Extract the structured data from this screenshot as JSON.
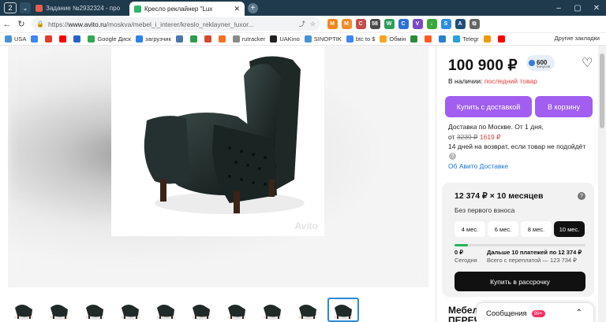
{
  "browser": {
    "tab_count": "2",
    "tabs": [
      {
        "title": "Задание №2932324 - про",
        "color": "#e65c4f",
        "active": false
      },
      {
        "title": "Кресло реклайнер \"Lux",
        "color": "#2fb36b",
        "active": true
      }
    ],
    "url_prefix": "https://",
    "url_host": "www.avito.ru",
    "url_path": "/moskva/mebel_i_interer/kreslo_reklayner_luxor...",
    "window_controls": [
      "–",
      "▢",
      "✕"
    ],
    "extensions": [
      {
        "name": "metamask-icon",
        "color": "#f6851b",
        "label": "M"
      },
      {
        "name": "ext-icon-2",
        "color": "#f28c28",
        "label": "M"
      },
      {
        "name": "ext-icon-3",
        "color": "#c94b4b",
        "label": "C"
      },
      {
        "name": "ltc-icon",
        "color": "#4a4a4a",
        "label": "58"
      },
      {
        "name": "ext-icon-5",
        "color": "#2f9c5a",
        "label": "W"
      },
      {
        "name": "ext-icon-6",
        "color": "#2c6fd6",
        "label": "C"
      },
      {
        "name": "ext-icon-7",
        "color": "#7a49c8",
        "label": "V"
      },
      {
        "name": "download-icon",
        "color": "#38a838",
        "label": "↓"
      },
      {
        "name": "ext-icon-9",
        "color": "#2b8de0",
        "label": "S"
      },
      {
        "name": "ext-icon-10",
        "color": "#1f4e79",
        "label": "A"
      },
      {
        "name": "puzzle-icon",
        "color": "#666666",
        "label": "⧉"
      }
    ],
    "bookmarks": [
      {
        "label": "USA",
        "color": "#4a90d9"
      },
      {
        "label": "",
        "color": "#4285f4"
      },
      {
        "label": "",
        "color": "#e33b2e"
      },
      {
        "label": "",
        "color": "#ff0000"
      },
      {
        "label": "",
        "color": "#2563c9"
      },
      {
        "label": "Google Диск",
        "color": "#34a853"
      },
      {
        "label": "загрузчик",
        "color": "#2f80ed"
      },
      {
        "label": "",
        "color": "#4a76a8"
      },
      {
        "label": "",
        "color": "#2c9c4e"
      },
      {
        "label": "",
        "color": "#d04a2f"
      },
      {
        "label": "",
        "color": "#f37021"
      },
      {
        "label": "rutracker",
        "color": "#8a8a8a"
      },
      {
        "label": "UAKino",
        "color": "#222222"
      },
      {
        "label": "SINOPTIK",
        "color": "#4a90d9"
      },
      {
        "label": "btc to $",
        "color": "#4285f4"
      },
      {
        "label": "Обмін",
        "color": "#f5a623"
      },
      {
        "label": "",
        "color": "#2c8c3c"
      },
      {
        "label": "",
        "color": "#ff5a1f"
      },
      {
        "label": "",
        "color": "#2d7dd2"
      },
      {
        "label": "Telegr",
        "color": "#2aa1da"
      },
      {
        "label": "",
        "color": "#f29900"
      },
      {
        "label": "",
        "color": "#ff0000"
      }
    ],
    "other_bookmarks": "Другие закладки"
  },
  "product": {
    "watermark": "Avito",
    "price": "100 900 ₽",
    "bonus_amount": "600",
    "bonus_label": "бонусов",
    "stock_label": "В наличии:",
    "stock_value": "последний товар",
    "buy_delivery": "Купить с доставкой",
    "to_cart": "В корзину",
    "delivery_line1": "Доставка по Москве. От 1 дня,",
    "delivery_from": "от",
    "delivery_old_price": "3239 ₽",
    "delivery_new_price": "1619 ₽",
    "return_policy": "14 дней на возврат, если товар не подойдёт",
    "delivery_link": "Об Авито Доставке",
    "title_partial": "Мебел",
    "title_partial_2": "ПЕРЕЧ"
  },
  "installment": {
    "title": "12 374 ₽ × 10 месяцев",
    "subtitle": "Без первого взноса",
    "terms": [
      "4 мес.",
      "6 мес.",
      "8 мес.",
      "10 мес."
    ],
    "selected_term": "10 мес.",
    "progress": 0.1,
    "now_amount": "0 ₽",
    "now_label": "Сегодня",
    "later_text": "Дальше 10 платежей по 12 374 ₽",
    "later_total": "Всего с переплатой — 123 734 ₽",
    "button": "Купить в рассрочку"
  },
  "messages": {
    "label": "Сообщения",
    "badge": "99+"
  },
  "colors": {
    "accent": "#a15ef0",
    "link": "#1a73d8",
    "alert": "#e14040",
    "progress": "#27b35a"
  }
}
